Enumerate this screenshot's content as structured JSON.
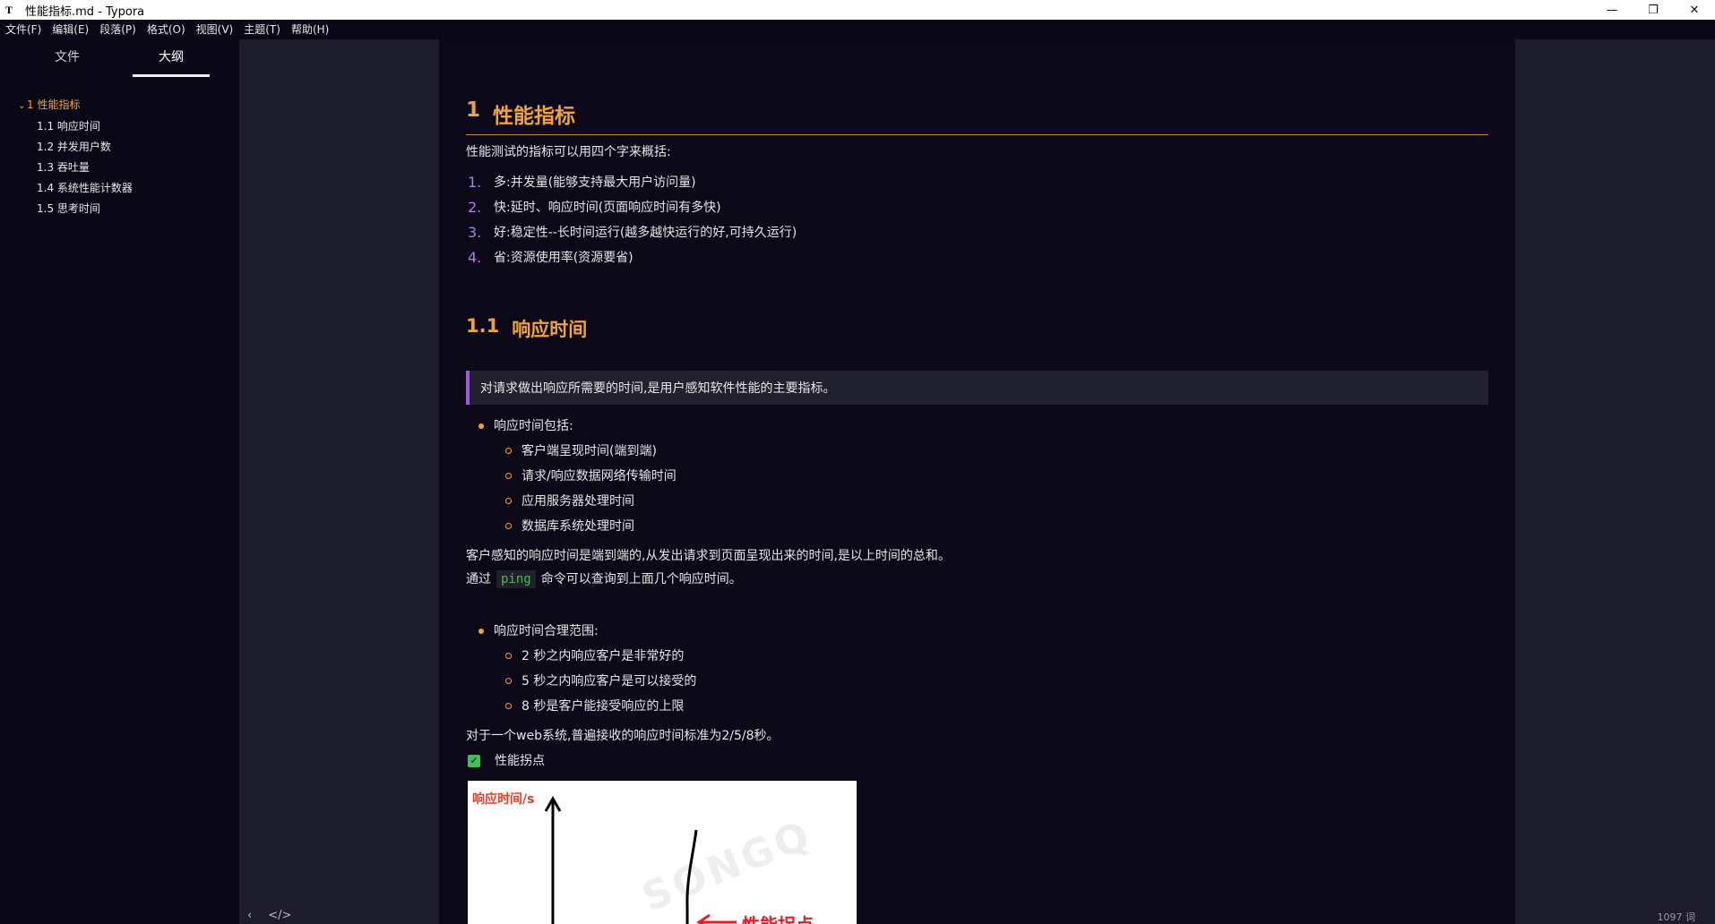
{
  "window": {
    "app_icon": "T",
    "title": "性能指标.md - Typora",
    "minimize": "—",
    "restore": "❐",
    "close": "✕"
  },
  "menu": [
    "文件(F)",
    "编辑(E)",
    "段落(P)",
    "格式(O)",
    "视图(V)",
    "主题(T)",
    "帮助(H)"
  ],
  "sidebar": {
    "tabs": [
      "文件",
      "大纲"
    ],
    "active_tab": "大纲",
    "outline": [
      {
        "label": "1 性能指标",
        "level": 1,
        "expanded": true
      },
      {
        "label": "1.1 响应时间",
        "level": 2
      },
      {
        "label": "1.2 并发用户数",
        "level": 2
      },
      {
        "label": "1.3 吞吐量",
        "level": 2
      },
      {
        "label": "1.4 系统性能计数器",
        "level": 2
      },
      {
        "label": "1.5 思考时间",
        "level": 2
      }
    ]
  },
  "footer": {
    "back_icon": "‹",
    "source_icon": "</>",
    "word_count": "1097 词"
  },
  "document": {
    "h1_num": "1",
    "h1_text": "性能指标",
    "intro": "性能测试的指标可以用四个字来概括:",
    "numbered": [
      {
        "num": "1.",
        "text": "多:并发量(能够支持最大用户访问量)"
      },
      {
        "num": "2.",
        "text": "快:延时、响应时间(页面响应时间有多快)"
      },
      {
        "num": "3.",
        "text": "好:稳定性--长时间运行(越多越快运行的好,可持久运行)"
      },
      {
        "num": "4.",
        "text": "省:资源使用率(资源要省)"
      }
    ],
    "h2_num": "1.1",
    "h2_text": "响应时间",
    "quote": "对请求做出响应所需要的时间,是用户感知软件性能的主要指标。",
    "bullet1": "响应时间包括:",
    "bullet1_sub": [
      "客户端呈现时间(端到端)",
      "请求/响应数据网络传输时间",
      "应用服务器处理时间",
      "数据库系统处理时间"
    ],
    "para1": "客户感知的响应时间是端到端的,从发出请求到页面呈现出来的时间,是以上时间的总和。",
    "para2_before": "通过",
    "para2_code": "ping",
    "para2_after": "命令可以查询到上面几个响应时间。",
    "bullet2": "响应时间合理范围:",
    "bullet2_sub": [
      "2 秒之内响应客户是非常好的",
      "5 秒之内响应客户是可以接受的",
      "8 秒是客户能接受响应的上限"
    ],
    "para3": "对于一个web系统,普遍接收的响应时间标准为2/5/8秒。",
    "task_label": "性能拐点",
    "task_checked": true,
    "image": {
      "y_label": "响应时间/s",
      "label": "性能拐点",
      "watermark": "SONGQ"
    }
  },
  "colors": {
    "heading": "#f2a338",
    "list_number": "#b17de8",
    "quote_border": "#9a5cd8",
    "code": "#3fbf5a",
    "page_bg": "#0b0818",
    "outer_bg": "#1d1c2c"
  }
}
